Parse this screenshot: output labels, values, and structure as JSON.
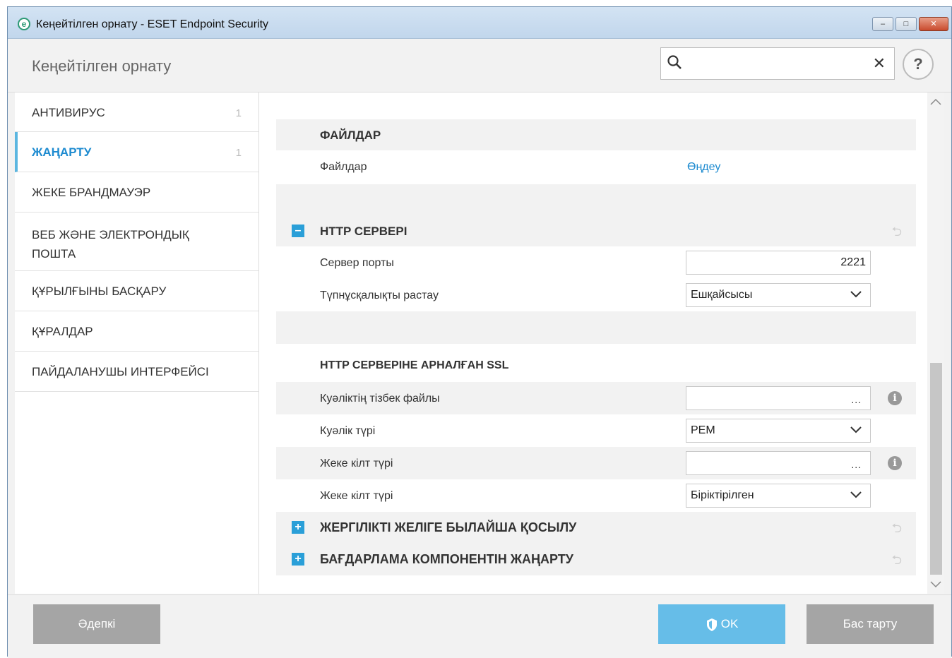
{
  "window": {
    "title": "Кеңейтілген орнату - ESET Endpoint Security",
    "logo_letter": "e",
    "minimize_icon": "–",
    "maximize_icon": "□",
    "close_icon": "✕"
  },
  "header": {
    "title": "Кеңейтілген орнату",
    "search_value": "",
    "search_placeholder": "",
    "clear_icon": "✕",
    "help_icon": "?"
  },
  "sidebar": {
    "items": [
      {
        "label": "АНТИВИРУС",
        "count": "1",
        "active": false
      },
      {
        "label": "ЖАҢАРТУ",
        "count": "1",
        "active": true
      },
      {
        "label": "ЖЕКЕ БРАНДМАУЭР",
        "count": "",
        "active": false
      },
      {
        "label": "ВЕБ ЖӘНЕ ЭЛЕКТРОНДЫҚ ПОШТА",
        "count": "",
        "active": false
      },
      {
        "label": "ҚҰРЫЛҒЫНЫ БАСҚАРУ",
        "count": "",
        "active": false
      },
      {
        "label": "ҚҰРАЛДАР",
        "count": "",
        "active": false
      },
      {
        "label": "ПАЙДАЛАНУШЫ ИНТЕРФЕЙСІ",
        "count": "",
        "active": false
      }
    ]
  },
  "content": {
    "files_section": {
      "title": "ФАЙЛДАР",
      "files_label": "Файлдар",
      "files_link": "Өңдеу"
    },
    "http_server": {
      "title": "HTTP СЕРВЕРІ",
      "toggle": "–",
      "port_label": "Сервер порты",
      "port_value": "2221",
      "auth_label": "Түпнұсқалықты растау",
      "auth_value": "Ешқайсысы"
    },
    "ssl": {
      "title": "HTTP СЕРВЕРІНЕ АРНАЛҒАН SSL",
      "cert_chain_label": "Куәліктің тізбек файлы",
      "cert_chain_value": "",
      "cert_type_label": "Куәлік түрі",
      "cert_type_value": "PEM",
      "private_key_label": "Жеке кілт түрі",
      "private_key_value": "",
      "private_key_type_label": "Жеке кілт түрі",
      "private_key_type_value": "Біріктірілген",
      "browse_dots": "...",
      "info_icon": "i"
    },
    "lan": {
      "title": "ЖЕРГІЛІКТІ ЖЕЛІГЕ БЫЛАЙША ҚОСЫЛУ",
      "toggle": "+"
    },
    "program_update": {
      "title": "БАҒДАРЛАМА КОМПОНЕНТІН ЖАҢАРТУ",
      "toggle": "+"
    },
    "revert_icon": "⮌"
  },
  "footer": {
    "default_label": "Әдепкі",
    "ok_label": "OK",
    "cancel_label": "Бас тарту"
  }
}
